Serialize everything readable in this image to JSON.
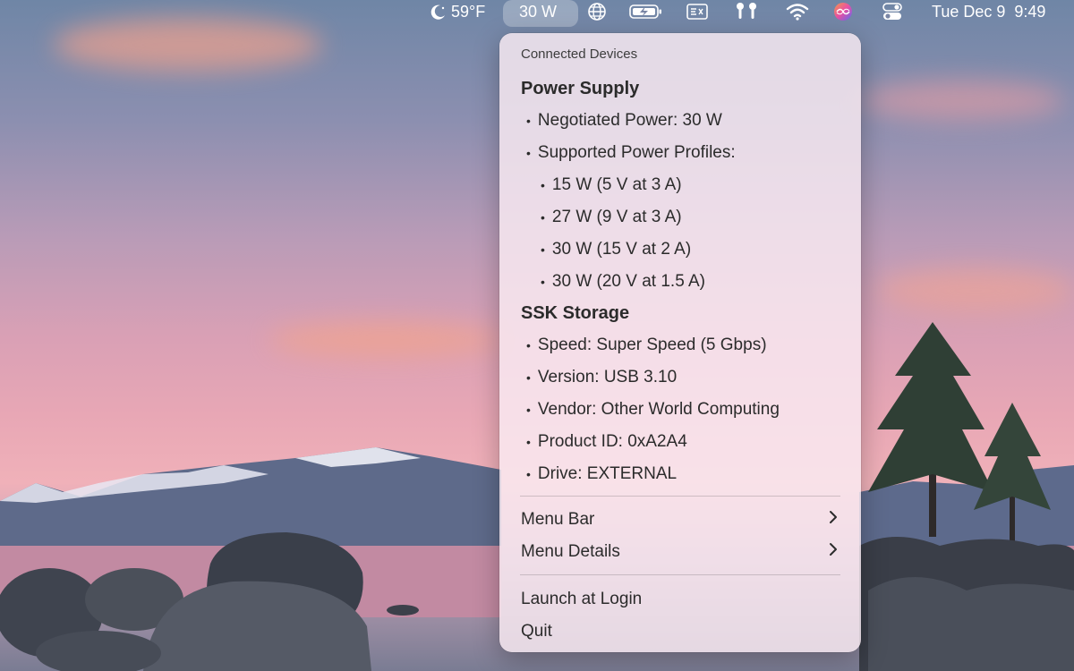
{
  "colors": {
    "menu_background": "#faecf3",
    "menu_text": "#2b2b2b",
    "menubar_text": "#ffffff"
  },
  "menubar": {
    "weather": "59°F",
    "power_indicator": "30 W",
    "datetime": "Tue Dec 9  9:49",
    "icons": [
      "moon-icon",
      "globe-icon",
      "battery-charging-icon",
      "keyboard-input-icon",
      "airpods-icon",
      "wifi-icon",
      "siri-icon",
      "control-center-icon"
    ]
  },
  "menu": {
    "header": "Connected Devices",
    "sections": [
      {
        "title": "Power Supply",
        "items": [
          {
            "level": 1,
            "text": "Negotiated Power: 30 W"
          },
          {
            "level": 1,
            "text": "Supported Power Profiles:"
          },
          {
            "level": 2,
            "text": "15 W (5 V at 3 A)"
          },
          {
            "level": 2,
            "text": "27 W (9 V at 3 A)"
          },
          {
            "level": 2,
            "text": "30 W (15 V at 2 A)"
          },
          {
            "level": 2,
            "text": "30 W (20 V at 1.5 A)"
          }
        ]
      },
      {
        "title": "SSK Storage",
        "items": [
          {
            "level": 1,
            "text": "Speed: Super Speed (5 Gbps)"
          },
          {
            "level": 1,
            "text": "Version: USB 3.10"
          },
          {
            "level": 1,
            "text": "Vendor: Other World Computing"
          },
          {
            "level": 1,
            "text": "Product ID: 0xA2A4"
          },
          {
            "level": 1,
            "text": "Drive: EXTERNAL"
          }
        ]
      }
    ],
    "submenus": [
      "Menu Bar",
      "Menu Details"
    ],
    "actions": [
      "Launch at Login",
      "Quit"
    ]
  }
}
